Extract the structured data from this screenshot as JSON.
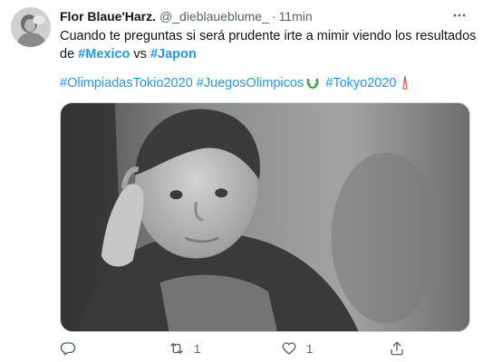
{
  "tweet": {
    "author_name": "Flor Blaue'Harz.",
    "handle": "@_dieblaueblume_",
    "separator": "·",
    "time": "11min",
    "text_line1": "Cuando te preguntas si será prudente irte a mimir viendo los resultados",
    "text_line2_prefix": "de ",
    "hashtag_mexico": "#Mexico",
    "text_vs": " vs ",
    "hashtag_japon": "#Japon",
    "hashtags": [
      "#OlimpiadasTokio2020",
      "#JuegosOlimpicos",
      "#Tokyo2020"
    ],
    "emoji": [
      "laurel-wreath-icon",
      "tokyo-tower-icon"
    ],
    "media_icon": "child-thinking-photo"
  },
  "actions": {
    "reply_count": "",
    "retweet_count": "1",
    "like_count": "1",
    "icons": [
      "reply-icon",
      "retweet-icon",
      "like-icon",
      "share-icon"
    ]
  },
  "colors": {
    "text": "#0f1419",
    "secondary": "#536471",
    "accent": "#1d9bf0"
  }
}
